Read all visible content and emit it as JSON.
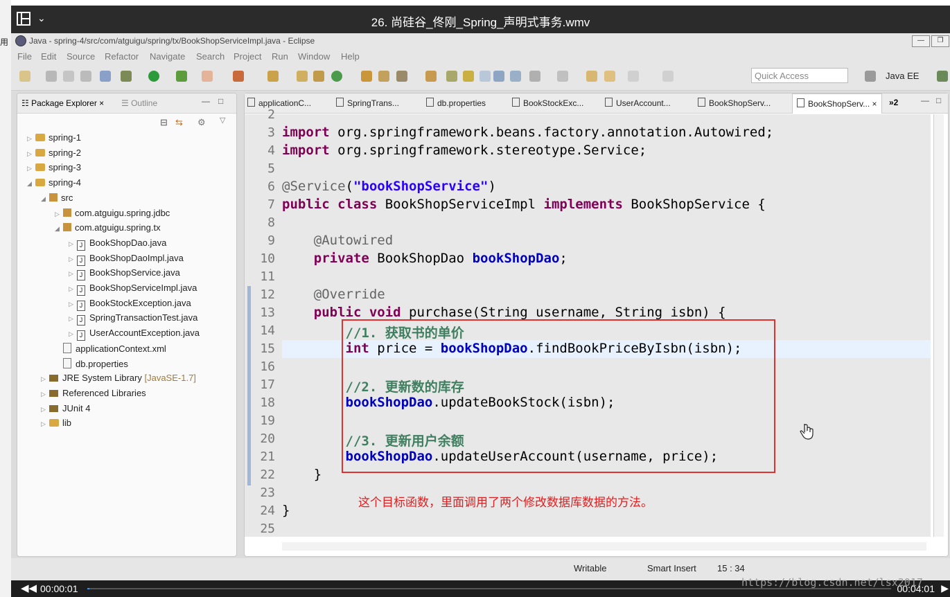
{
  "player": {
    "title": "26. 尚硅谷_佟刚_Spring_声明式事务.wmv",
    "time_current": "00:00:01",
    "time_total": "00:04:01",
    "progress_fraction": 0.003
  },
  "left_strip_char": "用",
  "eclipse": {
    "window_title": "Java - spring-4/src/com/atguigu/spring/tx/BookShopServiceImpl.java - Eclipse",
    "menu": [
      "File",
      "Edit",
      "Source",
      "Refactor",
      "Navigate",
      "Search",
      "Project",
      "Run",
      "Window",
      "Help"
    ],
    "quick_access_placeholder": "Quick Access",
    "perspective": "Java EE"
  },
  "package_explorer": {
    "tab_label": "Package Explorer",
    "outline_label": "Outline",
    "items": [
      {
        "label": "spring-1",
        "depth": 0,
        "kind": "project",
        "expanded": false
      },
      {
        "label": "spring-2",
        "depth": 0,
        "kind": "project",
        "expanded": false
      },
      {
        "label": "spring-3",
        "depth": 0,
        "kind": "project",
        "expanded": false
      },
      {
        "label": "spring-4",
        "depth": 0,
        "kind": "project",
        "expanded": true
      },
      {
        "label": "src",
        "depth": 1,
        "kind": "src",
        "expanded": true
      },
      {
        "label": "com.atguigu.spring.jdbc",
        "depth": 2,
        "kind": "pkg",
        "expanded": false
      },
      {
        "label": "com.atguigu.spring.tx",
        "depth": 2,
        "kind": "pkg",
        "expanded": true
      },
      {
        "label": "BookShopDao.java",
        "depth": 3,
        "kind": "java",
        "expanded": false
      },
      {
        "label": "BookShopDaoImpl.java",
        "depth": 3,
        "kind": "java",
        "expanded": false
      },
      {
        "label": "BookShopService.java",
        "depth": 3,
        "kind": "java",
        "expanded": false
      },
      {
        "label": "BookShopServiceImpl.java",
        "depth": 3,
        "kind": "java",
        "expanded": false
      },
      {
        "label": "BookStockException.java",
        "depth": 3,
        "kind": "java",
        "expanded": false
      },
      {
        "label": "SpringTransactionTest.java",
        "depth": 3,
        "kind": "java",
        "expanded": false
      },
      {
        "label": "UserAccountException.java",
        "depth": 3,
        "kind": "java",
        "expanded": false
      },
      {
        "label": "applicationContext.xml",
        "depth": 2,
        "kind": "file",
        "expanded": null
      },
      {
        "label": "db.properties",
        "depth": 2,
        "kind": "file",
        "expanded": null
      },
      {
        "label": "JRE System Library",
        "suffix": "[JavaSE-1.7]",
        "depth": 1,
        "kind": "lib",
        "expanded": false
      },
      {
        "label": "Referenced Libraries",
        "depth": 1,
        "kind": "lib",
        "expanded": false
      },
      {
        "label": "JUnit 4",
        "depth": 1,
        "kind": "lib",
        "expanded": false
      },
      {
        "label": "lib",
        "depth": 1,
        "kind": "folder",
        "expanded": false
      }
    ]
  },
  "editor": {
    "tabs": [
      "applicationC...",
      "SpringTrans...",
      "db.properties",
      "BookStockExc...",
      "UserAccount...",
      "BookShopServ...",
      "BookShopServ..."
    ],
    "active_tab": 6,
    "overflow_count": "»2",
    "lines": [
      {
        "n": "2",
        "html": ""
      },
      {
        "n": "3",
        "html": "<span class='kw'>import</span> org.springframework.beans.factory.annotation.Autowired;"
      },
      {
        "n": "4",
        "html": "<span class='kw'>import</span> org.springframework.stereotype.Service;"
      },
      {
        "n": "5",
        "html": ""
      },
      {
        "n": "6",
        "html": "<span class='an'>@Service</span>(<span class='str'>\"bookShopService\"</span>)"
      },
      {
        "n": "7",
        "html": "<span class='kw'>public class</span> BookShopServiceImpl <span class='kw'>implements</span> BookShopService {"
      },
      {
        "n": "8",
        "html": ""
      },
      {
        "n": "9",
        "html": "    <span class='an'>@Autowired</span>"
      },
      {
        "n": "10",
        "html": "    <span class='kw'>private</span> BookShopDao <span class='fld'>bookShopDao</span>;"
      },
      {
        "n": "11",
        "html": ""
      },
      {
        "n": "12",
        "html": "    <span class='an'>@Override</span>"
      },
      {
        "n": "13",
        "html": "    <span class='kw'>public void</span> purchase(String username, String isbn) {"
      },
      {
        "n": "14",
        "html": "        <span class='cm'>//1. 获取书的单价</span>"
      },
      {
        "n": "15",
        "html": "        <span class='kw'>int</span> price = <span class='fld'>bookShopDao</span>.findBookPriceByIsbn(isbn);"
      },
      {
        "n": "16",
        "html": ""
      },
      {
        "n": "17",
        "html": "        <span class='cm'>//2. 更新数的库存</span>"
      },
      {
        "n": "18",
        "html": "        <span class='fld'>bookShopDao</span>.updateBookStock(isbn);"
      },
      {
        "n": "19",
        "html": ""
      },
      {
        "n": "20",
        "html": "        <span class='cm'>//3. 更新用户余额</span>"
      },
      {
        "n": "21",
        "html": "        <span class='fld'>bookShopDao</span>.updateUserAccount(username, price);"
      },
      {
        "n": "22",
        "html": "    }"
      },
      {
        "n": "23",
        "html": ""
      },
      {
        "n": "24",
        "html": "}"
      },
      {
        "n": "25",
        "html": ""
      }
    ],
    "annotation_note": "这个目标函数，里面调用了两个修改数据库数据的方法。"
  },
  "status": {
    "writable": "Writable",
    "insert_mode": "Smart Insert",
    "position": "15 : 34"
  },
  "watermark": "https://blog.csdn.net/lsx2017"
}
